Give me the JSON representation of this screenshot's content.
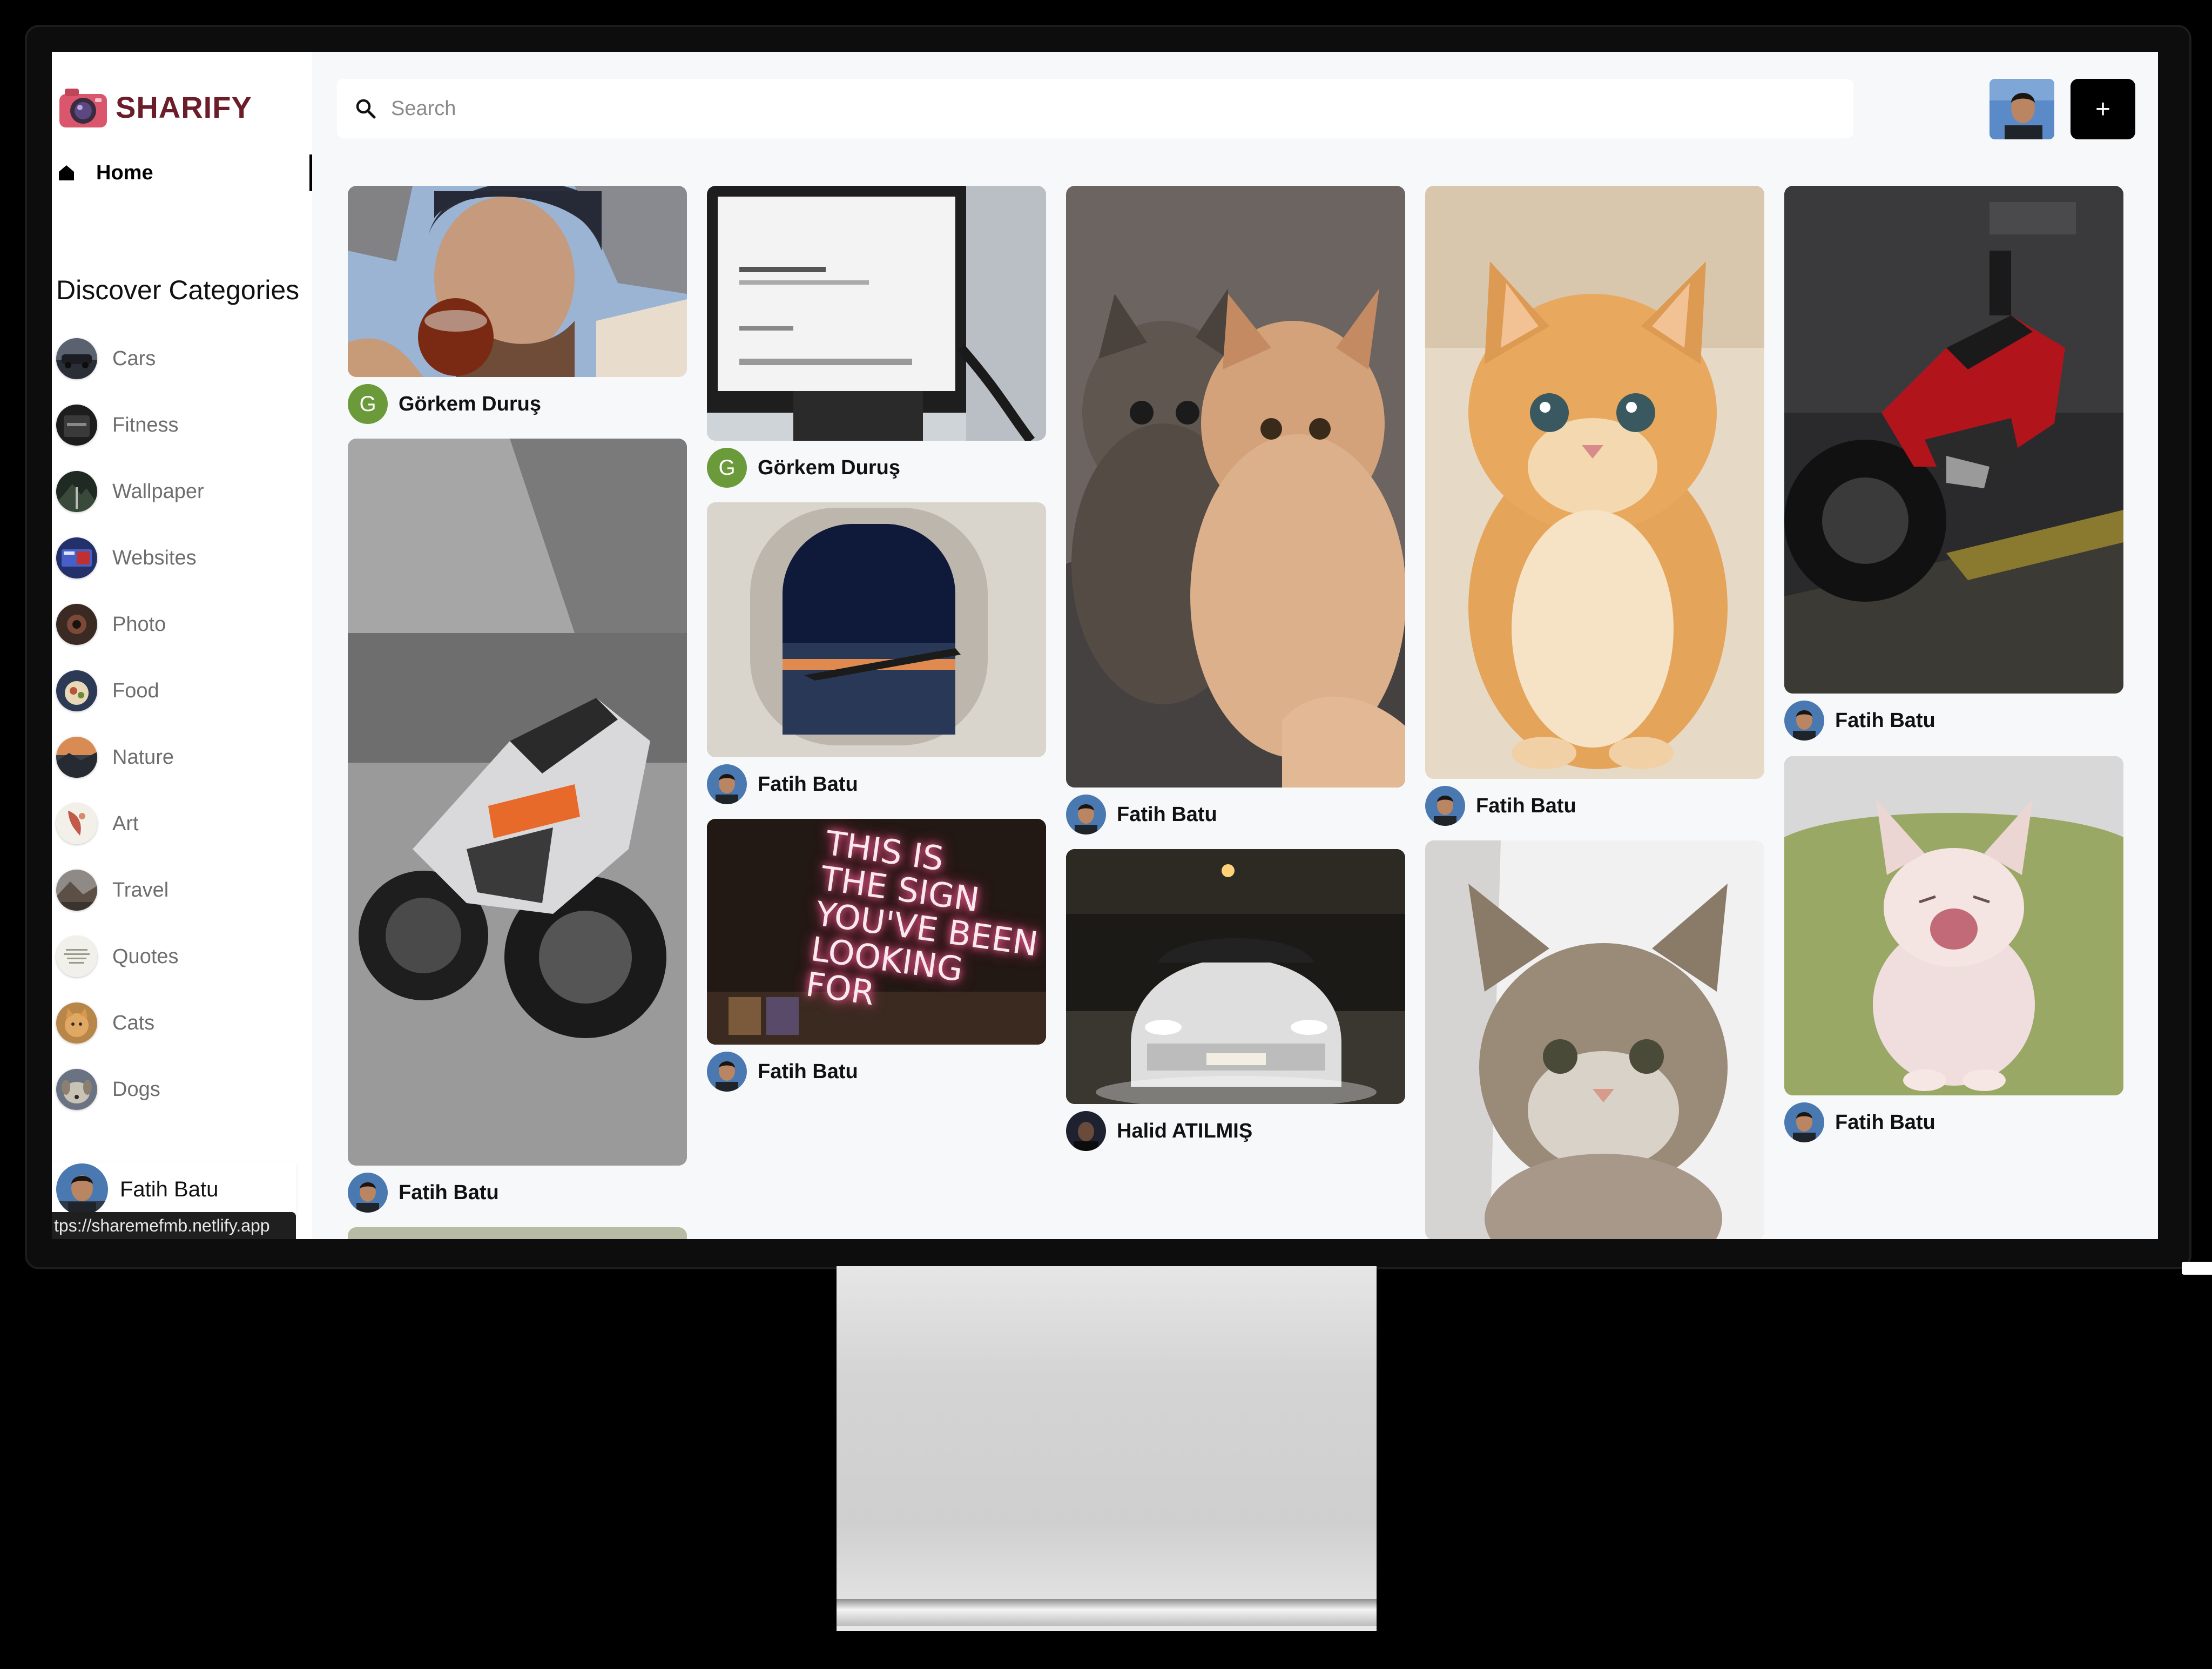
{
  "app": {
    "brand": "SHARIFY"
  },
  "nav": {
    "home_label": "Home"
  },
  "categories": {
    "title": "Discover Categories",
    "items": [
      {
        "label": "Cars"
      },
      {
        "label": "Fitness"
      },
      {
        "label": "Wallpaper"
      },
      {
        "label": "Websites"
      },
      {
        "label": "Photo"
      },
      {
        "label": "Food"
      },
      {
        "label": "Nature"
      },
      {
        "label": "Art"
      },
      {
        "label": "Travel"
      },
      {
        "label": "Quotes"
      },
      {
        "label": "Cats"
      },
      {
        "label": "Dogs"
      }
    ]
  },
  "search": {
    "placeholder": "Search"
  },
  "header": {
    "add_label": "+"
  },
  "sidebar_user": {
    "name": "Fatih Batu"
  },
  "status_bar": {
    "url": "tps://sharemefmb.netlify.app"
  },
  "pins": [
    {
      "user": "Görkem Duruş",
      "avatar_letter": "G",
      "image": "man-drinking-tea-photo"
    },
    {
      "user": "Fatih Batu",
      "image": "white-motorcycle-photo"
    },
    {
      "user": "Görkem Duruş",
      "avatar_letter": "G",
      "image": "laptop-screen-photo"
    },
    {
      "user": "Fatih Batu",
      "image": "airplane-window-photo"
    },
    {
      "user": "Fatih Batu",
      "image": "neon-sign-photo",
      "neon_text": [
        "THIS IS",
        "THE SIGN",
        "YOU'VE BEEN",
        "LOOKING FOR"
      ]
    },
    {
      "user": "Fatih Batu",
      "image": "two-cats-photo"
    },
    {
      "user": "Halid ATILMIŞ",
      "image": "white-car-night-photo"
    },
    {
      "user": "Fatih Batu",
      "image": "orange-kitten-photo"
    },
    {
      "user": "",
      "image": "tabby-kitten-photo"
    },
    {
      "user": "Fatih Batu",
      "image": "red-motorcycle-photo"
    },
    {
      "user": "Fatih Batu",
      "image": "yawning-kitten-photo"
    }
  ],
  "colors": {
    "brand": "#6b1d2a",
    "add_button": "#000000",
    "letter_avatar": "#6a9a3a"
  }
}
